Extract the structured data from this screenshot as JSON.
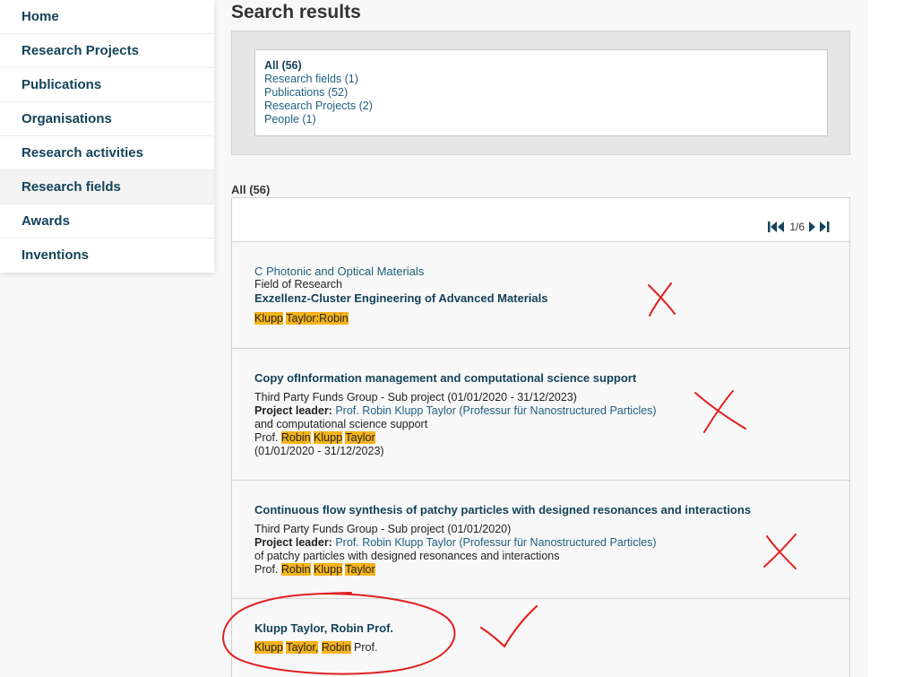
{
  "sidebar": {
    "items": [
      {
        "label": "Home"
      },
      {
        "label": "Research Projects"
      },
      {
        "label": "Publications"
      },
      {
        "label": "Organisations"
      },
      {
        "label": "Research activities"
      },
      {
        "label": "Research fields"
      },
      {
        "label": "Awards"
      },
      {
        "label": "Inventions"
      }
    ]
  },
  "main": {
    "title": "Search results",
    "filters": [
      {
        "label": "All (56)"
      },
      {
        "label": "Research fields (1)"
      },
      {
        "label": "Publications (52)"
      },
      {
        "label": "Research Projects (2)"
      },
      {
        "label": "People (1)"
      }
    ],
    "results_label": "All (56)",
    "pager": {
      "page": "1/6"
    }
  },
  "results": [
    {
      "title": "C Photonic and Optical Materials",
      "type": "Field of Research",
      "subtitle": "Exzellenz-Cluster Engineering of Advanced Materials",
      "h1": "Klupp",
      "h2": "Taylor",
      "sep": ":",
      "h3": "Robin"
    },
    {
      "title": "Copy ofInformation management and computational science support",
      "meta": "Third Party Funds Group - Sub project (01/01/2020 - 31/12/2023)",
      "leader_label": "Project leader:",
      "leader": "Prof. Robin Klupp Taylor (Professur für Nanostructured Particles)",
      "snippet": "and computational science support",
      "prefix": "Prof.",
      "h1": "Robin",
      "h2": "Klupp",
      "h3": "Taylor",
      "dates": "(01/01/2020 - 31/12/2023)"
    },
    {
      "title": "Continuous flow synthesis of patchy particles with designed resonances and interactions",
      "meta": "Third Party Funds Group - Sub project (01/01/2020)",
      "leader_label": "Project leader:",
      "leader": "Prof. Robin Klupp Taylor (Professur für Nanostructured Particles)",
      "snippet": "of patchy particles with designed resonances and interactions",
      "prefix": "Prof.",
      "h1": "Robin",
      "h2": "Klupp",
      "h3": "Taylor"
    },
    {
      "title": "Klupp Taylor, Robin Prof.",
      "h1": "Klupp",
      "h2": "Taylor,",
      "h3": "Robin",
      "suffix": "Prof."
    }
  ],
  "colors": {
    "link_dark": "#14435a",
    "link": "#1f5f80",
    "highlight": "#f5b31c",
    "annotation": "#e02020"
  }
}
